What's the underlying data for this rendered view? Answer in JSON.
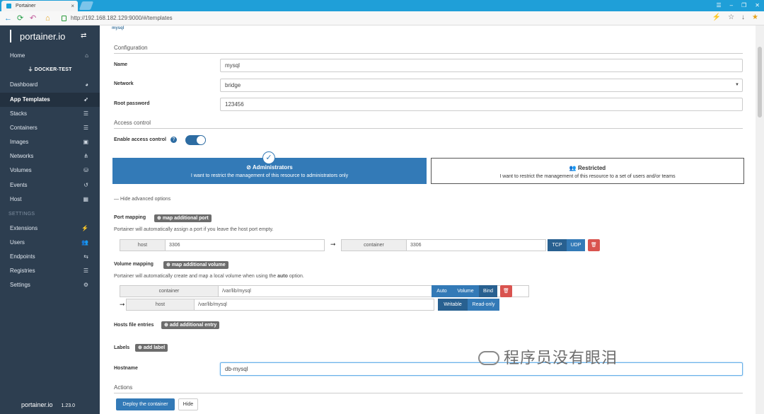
{
  "browser": {
    "tab_title": "Portainer",
    "tab_close": "×",
    "url": "http://192.168.182.129:9000/#/templates",
    "window_controls": [
      "☰",
      "–",
      "❐",
      "✕"
    ],
    "right_icons": [
      "⚡",
      "☆",
      "↓",
      "★"
    ]
  },
  "sidebar": {
    "logo": "portainer.io",
    "endpoint": "DOCKER-TEST",
    "items": [
      {
        "label": "Home",
        "icon": "⌂"
      },
      {
        "label": "Dashboard",
        "icon": "◕"
      },
      {
        "label": "App Templates",
        "icon": "➶"
      },
      {
        "label": "Stacks",
        "icon": "☰"
      },
      {
        "label": "Containers",
        "icon": "☰"
      },
      {
        "label": "Images",
        "icon": "▣"
      },
      {
        "label": "Networks",
        "icon": "⋔"
      },
      {
        "label": "Volumes",
        "icon": "⛁"
      },
      {
        "label": "Events",
        "icon": "↺"
      },
      {
        "label": "Host",
        "icon": "▦"
      }
    ],
    "settings_header": "SETTINGS",
    "settings_items": [
      {
        "label": "Extensions",
        "icon": "⚡"
      },
      {
        "label": "Users",
        "icon": "👥"
      },
      {
        "label": "Endpoints",
        "icon": "⇆"
      },
      {
        "label": "Registries",
        "icon": "☰"
      },
      {
        "label": "Settings",
        "icon": "⚙"
      }
    ],
    "footer_logo": "portainer.io",
    "footer_version": "1.23.0"
  },
  "form": {
    "mysql_logo": "mysql",
    "configuration_header": "Configuration",
    "name_label": "Name",
    "name_value": "mysql",
    "network_label": "Network",
    "network_value": "bridge",
    "root_password_label": "Root password",
    "root_password_value": "123456",
    "access_control_header": "Access control",
    "enable_access_label": "Enable access control",
    "admin_title": "Administrators",
    "admin_desc": "I want to restrict the management of this resource to administrators only",
    "restricted_title": "Restricted",
    "restricted_desc": "I want to restrict the management of this resource to a set of users and/or teams",
    "hide_advanced": "Hide advanced options",
    "port_mapping_label": "Port mapping",
    "map_port_btn": "map additional port",
    "port_help": "Portainer will automatically assign a port if you leave the host port empty.",
    "port_host_addon": "host",
    "port_host_value": "3306",
    "port_container_addon": "container",
    "port_container_value": "3306",
    "tcp": "TCP",
    "udp": "UDP",
    "volume_mapping_label": "Volume mapping",
    "map_volume_btn": "map additional volume",
    "volume_help_pre": "Portainer will automatically create and map a local volume when using the ",
    "volume_help_auto": "auto",
    "volume_help_post": " option.",
    "vol_container_addon": "container",
    "vol_container_value": "/var/lib/mysql",
    "auto": "Auto",
    "volume": "Volume",
    "bind": "Bind",
    "vol_host_addon": "host",
    "vol_host_value": "/var/lib/mysql",
    "writable": "Writable",
    "readonly": "Read-only",
    "hosts_label": "Hosts file entries",
    "add_entry_btn": "add additional entry",
    "labels_label": "Labels",
    "add_label_btn": "add label",
    "hostname_label": "Hostname",
    "hostname_value": "db-mysql",
    "actions_header": "Actions",
    "deploy": "Deploy the container",
    "hide": "Hide"
  },
  "watermark": "程序员没有眼泪"
}
